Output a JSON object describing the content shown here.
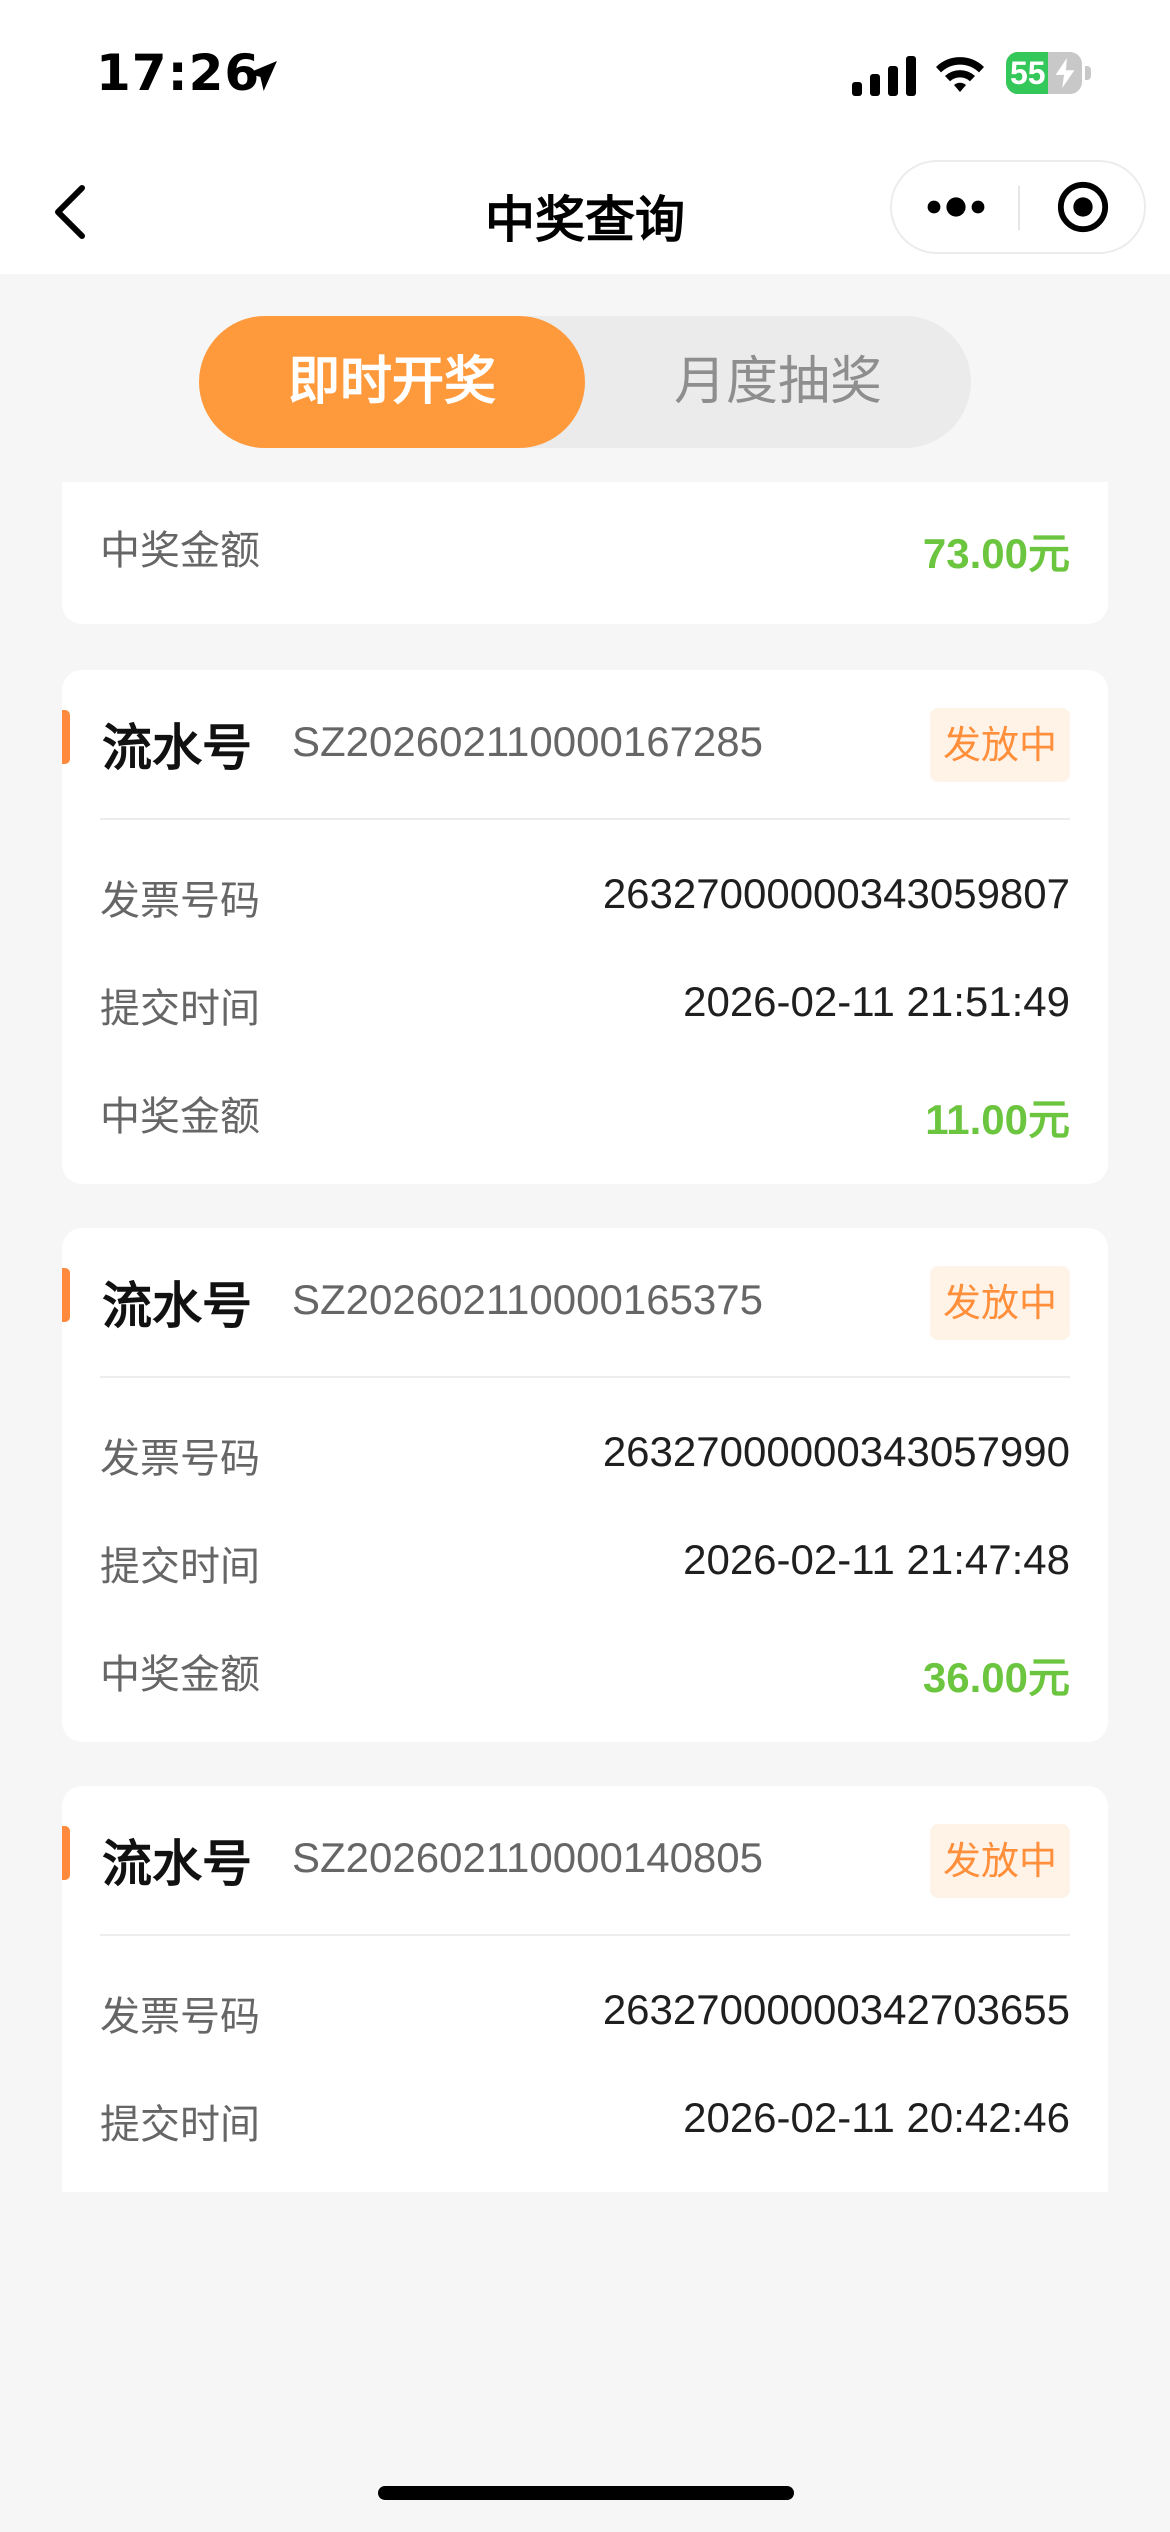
{
  "status_bar": {
    "time": "17:26",
    "battery_percent": "55",
    "battery_level": 0.55,
    "icons": [
      "location-arrow-icon",
      "cellular-signal-icon",
      "wifi-icon",
      "battery-charging-icon"
    ]
  },
  "nav": {
    "title": "中奖查询",
    "back_icon": "chevron-left-icon",
    "more_icon": "more-dots-icon",
    "close_icon": "target-circle-icon"
  },
  "tabs": [
    {
      "label": "即时开奖",
      "active": true
    },
    {
      "label": "月度抽奖",
      "active": false
    }
  ],
  "labels": {
    "serial": "流水号",
    "invoice_no": "发票号码",
    "submit_time": "提交时间",
    "prize_amount": "中奖金额"
  },
  "partial_card": {
    "prize_amount": "73.00元"
  },
  "records": [
    {
      "serial_no": "SZ202602110000167285",
      "status": "发放中",
      "invoice_no": "26327000000343059807",
      "submit_time": "2026-02-11 21:51:49",
      "prize_amount": "11.00元"
    },
    {
      "serial_no": "SZ202602110000165375",
      "status": "发放中",
      "invoice_no": "26327000000343057990",
      "submit_time": "2026-02-11 21:47:48",
      "prize_amount": "36.00元"
    },
    {
      "serial_no": "SZ202602110000140805",
      "status": "发放中",
      "invoice_no": "26327000000342703655",
      "submit_time": "2026-02-11 20:42:46"
    }
  ],
  "colors": {
    "accent": "#ff9a3c",
    "status_text": "#ff8f3a",
    "amount": "#6cc53f",
    "background": "#f6f6f6"
  }
}
